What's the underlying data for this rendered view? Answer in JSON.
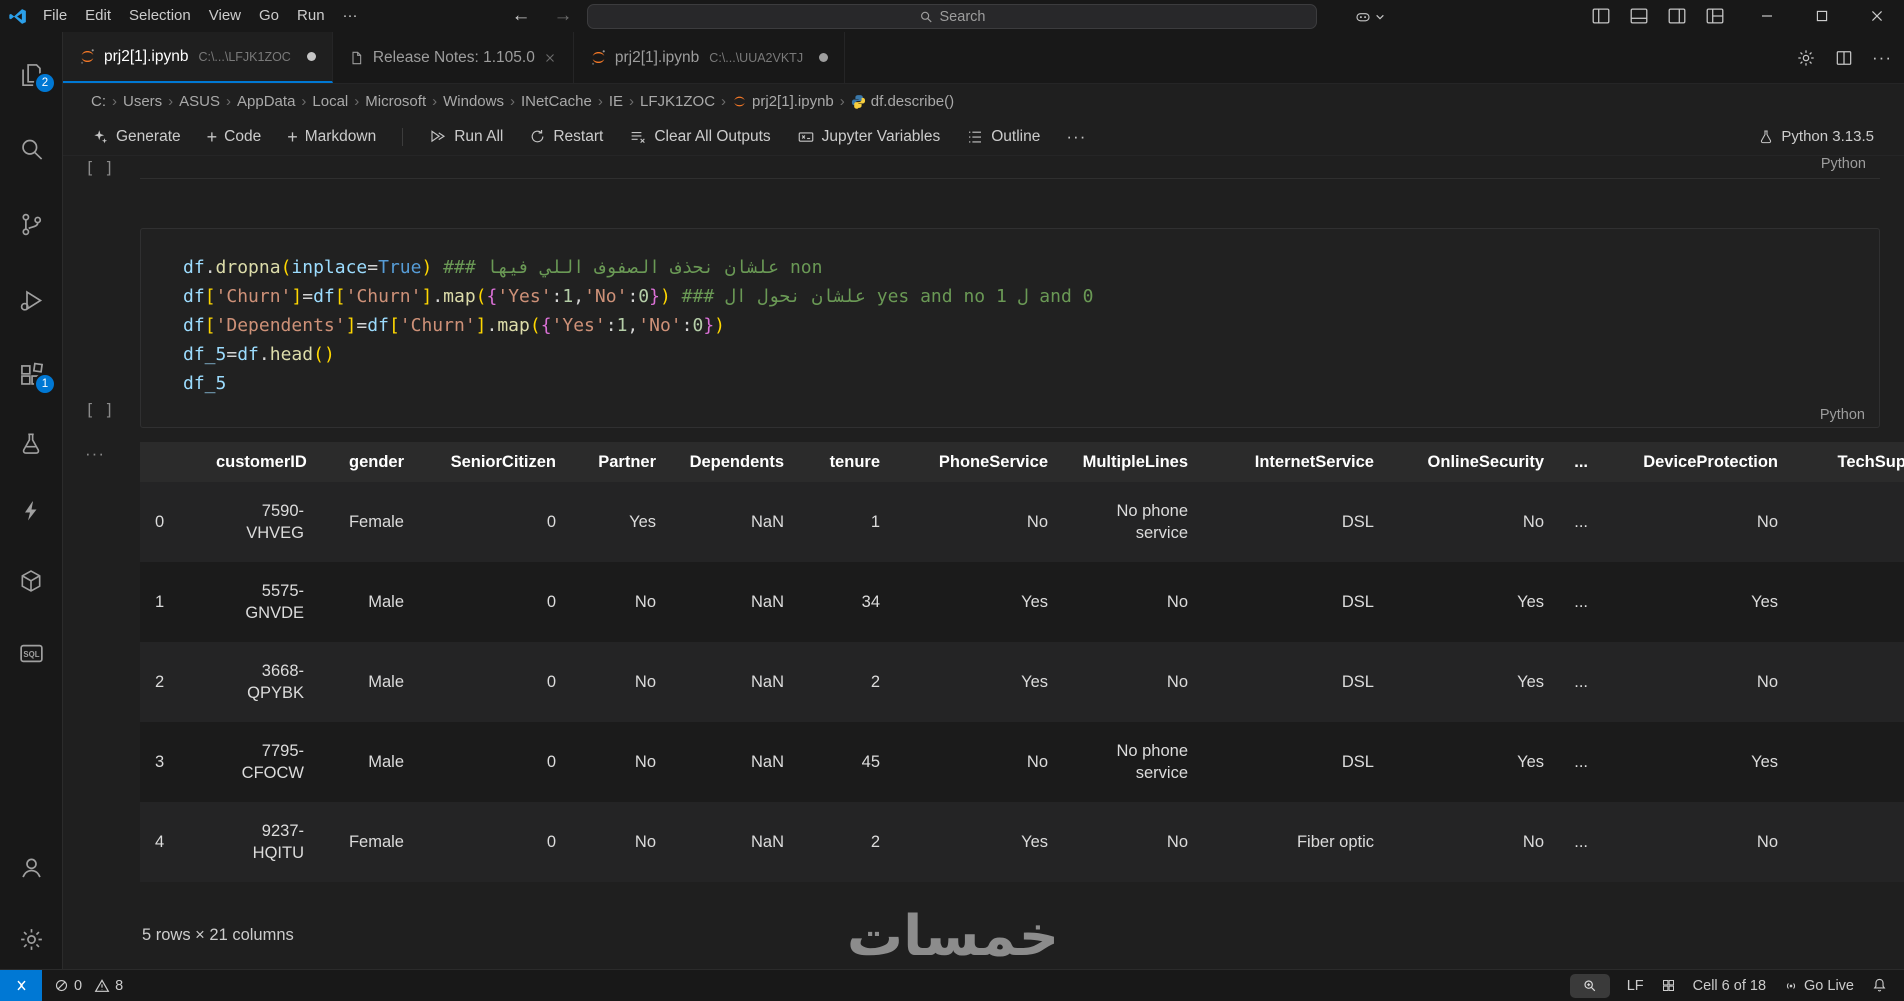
{
  "title_bar": {
    "menus": [
      "File",
      "Edit",
      "Selection",
      "View",
      "Go",
      "Run",
      "···"
    ],
    "search_placeholder": "Search"
  },
  "tabs": [
    {
      "title": "prj2[1].ipynb",
      "path": "C:\\...\\LFJK1ZOC",
      "dirty": true
    },
    {
      "title": "Release Notes: 1.105.0"
    },
    {
      "title": "prj2[1].ipynb",
      "path": "C:\\...\\UUA2VKTJ",
      "dirty": true
    }
  ],
  "editor_actions": {
    "more": "···"
  },
  "breadcrumbs": [
    {
      "label": "C:"
    },
    {
      "label": "Users"
    },
    {
      "label": "ASUS"
    },
    {
      "label": "AppData"
    },
    {
      "label": "Local"
    },
    {
      "label": "Microsoft"
    },
    {
      "label": "Windows"
    },
    {
      "label": "INetCache"
    },
    {
      "label": "IE"
    },
    {
      "label": "LFJK1ZOC"
    },
    {
      "label": "prj2[1].ipynb",
      "icon": "jupyter"
    },
    {
      "label": "df.describe()",
      "icon": "python"
    }
  ],
  "notebook_toolbar": {
    "generate": "Generate",
    "add_code": "Code",
    "add_markdown": "Markdown",
    "run_all": "Run All",
    "restart": "Restart",
    "clear_outputs": "Clear All Outputs",
    "variables": "Jupyter Variables",
    "outline": "Outline",
    "overflow": "···",
    "kernel": "Python 3.13.5"
  },
  "activity_bar": {
    "explorer_badge": "2",
    "extensions_badge": "1"
  },
  "cells": {
    "previous": {
      "exec_label": "[ ]",
      "lang": "Python"
    },
    "code": {
      "exec_label": "[ ]",
      "lang": "Python",
      "lines": [
        [
          {
            "c": "v",
            "t": "df"
          },
          {
            "c": "o",
            "t": "."
          },
          {
            "c": "f",
            "t": "dropna"
          },
          {
            "c": "b1",
            "t": "("
          },
          {
            "c": "v",
            "t": "inplace"
          },
          {
            "c": "o",
            "t": "="
          },
          {
            "c": "k",
            "t": "True"
          },
          {
            "c": "b1",
            "t": ")"
          },
          {
            "c": "o",
            "t": " "
          },
          {
            "c": "c",
            "t": "### علشان نحذف الصفوف اللي فيها non"
          }
        ],
        [
          {
            "c": "v",
            "t": "df"
          },
          {
            "c": "b1",
            "t": "["
          },
          {
            "c": "s",
            "t": "'Churn'"
          },
          {
            "c": "b1",
            "t": "]"
          },
          {
            "c": "o",
            "t": "="
          },
          {
            "c": "v",
            "t": "df"
          },
          {
            "c": "b1",
            "t": "["
          },
          {
            "c": "s",
            "t": "'Churn'"
          },
          {
            "c": "b1",
            "t": "]"
          },
          {
            "c": "o",
            "t": "."
          },
          {
            "c": "f",
            "t": "map"
          },
          {
            "c": "b1",
            "t": "("
          },
          {
            "c": "b2",
            "t": "{"
          },
          {
            "c": "s",
            "t": "'Yes'"
          },
          {
            "c": "o",
            "t": ":"
          },
          {
            "c": "n",
            "t": "1"
          },
          {
            "c": "o",
            "t": ","
          },
          {
            "c": "s",
            "t": "'No'"
          },
          {
            "c": "o",
            "t": ":"
          },
          {
            "c": "n",
            "t": "0"
          },
          {
            "c": "b2",
            "t": "}"
          },
          {
            "c": "b1",
            "t": ")"
          },
          {
            "c": "o",
            "t": " "
          },
          {
            "c": "c",
            "t": "### علشان نحول ال yes and no 1 ل and 0"
          }
        ],
        [
          {
            "c": "v",
            "t": "df"
          },
          {
            "c": "b1",
            "t": "["
          },
          {
            "c": "s",
            "t": "'Dependents'"
          },
          {
            "c": "b1",
            "t": "]"
          },
          {
            "c": "o",
            "t": "="
          },
          {
            "c": "v",
            "t": "df"
          },
          {
            "c": "b1",
            "t": "["
          },
          {
            "c": "s",
            "t": "'Churn'"
          },
          {
            "c": "b1",
            "t": "]"
          },
          {
            "c": "o",
            "t": "."
          },
          {
            "c": "f",
            "t": "map"
          },
          {
            "c": "b1",
            "t": "("
          },
          {
            "c": "b2",
            "t": "{"
          },
          {
            "c": "s",
            "t": "'Yes'"
          },
          {
            "c": "o",
            "t": ":"
          },
          {
            "c": "n",
            "t": "1"
          },
          {
            "c": "o",
            "t": ","
          },
          {
            "c": "s",
            "t": "'No'"
          },
          {
            "c": "o",
            "t": ":"
          },
          {
            "c": "n",
            "t": "0"
          },
          {
            "c": "b2",
            "t": "}"
          },
          {
            "c": "b1",
            "t": ")"
          }
        ],
        [
          {
            "c": "v",
            "t": "df_5"
          },
          {
            "c": "o",
            "t": "="
          },
          {
            "c": "v",
            "t": "df"
          },
          {
            "c": "o",
            "t": "."
          },
          {
            "c": "f",
            "t": "head"
          },
          {
            "c": "b1",
            "t": "("
          },
          {
            "c": "b1",
            "t": ")"
          }
        ],
        [
          {
            "c": "v",
            "t": "df_5"
          }
        ]
      ]
    }
  },
  "output": {
    "more": "···",
    "table": {
      "columns": [
        "",
        "customerID",
        "gender",
        "SeniorCitizen",
        "Partner",
        "Dependents",
        "tenure",
        "PhoneService",
        "MultipleLines",
        "InternetService",
        "OnlineSecurity",
        "...",
        "DeviceProtection",
        "TechSupport"
      ],
      "rows": [
        [
          "0",
          "7590-VHVEG",
          "Female",
          "0",
          "Yes",
          "NaN",
          "1",
          "No",
          "No phone service",
          "DSL",
          "No",
          "...",
          "No",
          ""
        ],
        [
          "1",
          "5575-GNVDE",
          "Male",
          "0",
          "No",
          "NaN",
          "34",
          "Yes",
          "No",
          "DSL",
          "Yes",
          "...",
          "Yes",
          ""
        ],
        [
          "2",
          "3668-QPYBK",
          "Male",
          "0",
          "No",
          "NaN",
          "2",
          "Yes",
          "No",
          "DSL",
          "Yes",
          "...",
          "No",
          ""
        ],
        [
          "3",
          "7795-CFOCW",
          "Male",
          "0",
          "No",
          "NaN",
          "45",
          "No",
          "No phone service",
          "DSL",
          "Yes",
          "...",
          "Yes",
          ""
        ],
        [
          "4",
          "9237-HQITU",
          "Female",
          "0",
          "No",
          "NaN",
          "2",
          "Yes",
          "No",
          "Fiber optic",
          "No",
          "...",
          "No",
          ""
        ]
      ]
    },
    "summary": "5 rows × 21 columns"
  },
  "watermark": {
    "text": "خمسات"
  },
  "status_bar": {
    "errors": "0",
    "warnings": "8",
    "eol": "LF",
    "cell_position": "Cell 6 of 18",
    "go_live": "Go Live"
  }
}
